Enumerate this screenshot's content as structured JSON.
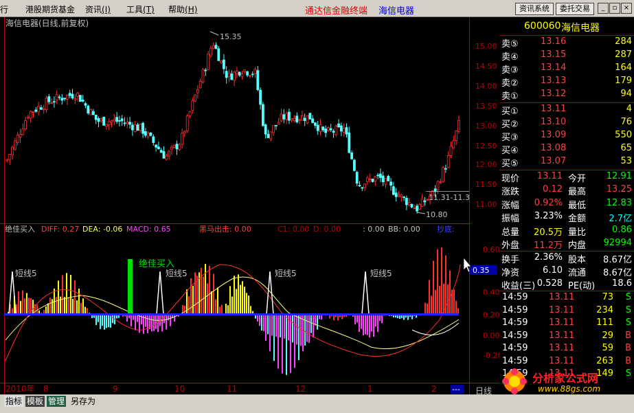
{
  "menubar": {
    "items": [
      "行",
      "港股期货基金",
      "资讯",
      "工具",
      "帮助"
    ],
    "brand": "通达信金融终端",
    "stock": "海信电器",
    "buttons": [
      "资讯系统",
      "委托交易"
    ],
    "win_icons": [
      "minimize-icon",
      "restore-icon",
      "close-icon"
    ]
  },
  "chart_title": "海信电器(日线,前复权)",
  "price_axis": [
    "15.00",
    "14.50",
    "14.00",
    "13.50",
    "13.00",
    "12.50",
    "12.00",
    "11.50",
    "11.00"
  ],
  "high_label": "15.35",
  "low_label": "10.80",
  "range_label": "11.31-11.3",
  "indicator": {
    "title": "绝佳买入",
    "diff": "DIFF: 0.27",
    "dea": "DEA: -0.06",
    "macd": "MACD: 0.65",
    "heima": "黑马出击: 0.00",
    "c1": "C1: 0.00",
    "d": "D: 0.00",
    "v": ": 0.00",
    "bb": "BB: 0.00",
    "cao": "抄底:",
    "buy_signal": "绝佳买入",
    "short_labels": [
      "短线5",
      "短线5",
      "短线5",
      "短线5"
    ],
    "axis": [
      "0.60",
      "0.40",
      "0.20",
      "0.00",
      "-0.20"
    ],
    "cursor_value": "0.35"
  },
  "time_axis": [
    "2010年",
    "8",
    "9",
    "10",
    "11",
    "12",
    "1",
    "2",
    "---"
  ],
  "period": "日线",
  "quote": {
    "code": "600060",
    "name": "海信电器",
    "asks": [
      {
        "label": "卖⑤",
        "price": "13.16",
        "vol": "284"
      },
      {
        "label": "卖④",
        "price": "13.15",
        "vol": "287"
      },
      {
        "label": "卖③",
        "price": "13.14",
        "vol": "164"
      },
      {
        "label": "卖②",
        "price": "13.13",
        "vol": "179"
      },
      {
        "label": "卖①",
        "price": "13.12",
        "vol": "94"
      }
    ],
    "bids": [
      {
        "label": "买①",
        "price": "13.11",
        "vol": "4"
      },
      {
        "label": "买②",
        "price": "13.10",
        "vol": "76"
      },
      {
        "label": "买③",
        "price": "13.09",
        "vol": "550"
      },
      {
        "label": "买④",
        "price": "13.08",
        "vol": "65"
      },
      {
        "label": "买⑤",
        "price": "13.07",
        "vol": "53"
      }
    ],
    "stats": [
      {
        "l1": "现价",
        "v1": "13.11",
        "c1": "#ff4040",
        "l2": "今开",
        "v2": "12.91",
        "c2": "#00ff00"
      },
      {
        "l1": "涨跌",
        "v1": "0.12",
        "c1": "#ff4040",
        "l2": "最高",
        "v2": "13.25",
        "c2": "#ff4040"
      },
      {
        "l1": "涨幅",
        "v1": "0.92%",
        "c1": "#ff4040",
        "l2": "最低",
        "v2": "12.83",
        "c2": "#00ff00"
      },
      {
        "l1": "振幅",
        "v1": "3.23%",
        "c1": "#ffffff",
        "l2": "金额",
        "v2": "2.7亿",
        "c2": "#00ffff"
      },
      {
        "l1": "总量",
        "v1": "20.5万",
        "c1": "#ffff00",
        "l2": "量比",
        "v2": "0.86",
        "c2": "#00ff00"
      },
      {
        "l1": "外盘",
        "v1": "11.2万",
        "c1": "#ff4040",
        "l2": "内盘",
        "v2": "92994",
        "c2": "#00ff00"
      },
      {
        "l1": "换手",
        "v1": "2.36%",
        "c1": "#ffffff",
        "l2": "股本",
        "v2": "8.67亿",
        "c2": "#ffffff"
      },
      {
        "l1": "净资",
        "v1": "6.10",
        "c1": "#ffffff",
        "l2": "流通",
        "v2": "8.67亿",
        "c2": "#ffffff"
      },
      {
        "l1": "收益(三)",
        "v1": "0.528",
        "c1": "#ffffff",
        "l2": "PE(动)",
        "v2": "18.6",
        "c2": "#ffffff"
      }
    ],
    "ticks": [
      {
        "t": "14:59",
        "p": "13.11",
        "v": "73",
        "s": "S"
      },
      {
        "t": "14:59",
        "p": "13.11",
        "v": "234",
        "s": "S"
      },
      {
        "t": "14:59",
        "p": "13.11",
        "v": "111",
        "s": "S"
      },
      {
        "t": "14:59",
        "p": "13.11",
        "v": "29",
        "s": "B"
      },
      {
        "t": "14:59",
        "p": "13.11",
        "v": "59",
        "s": "B"
      },
      {
        "t": "14:59",
        "p": "13.11",
        "v": "263",
        "s": "B"
      },
      {
        "t": "14:59",
        "p": "13.11",
        "v": "149",
        "s": "S"
      }
    ]
  },
  "bottom_tabs": [
    "指标",
    "模板",
    "管理",
    "另存为"
  ],
  "watermark": {
    "name": "分析家公式网",
    "url": "www.88gs.com"
  },
  "colors": {
    "up": "#ff3030",
    "down": "#54ffff",
    "axis": "#c00000",
    "label": "#c0c0c0"
  }
}
